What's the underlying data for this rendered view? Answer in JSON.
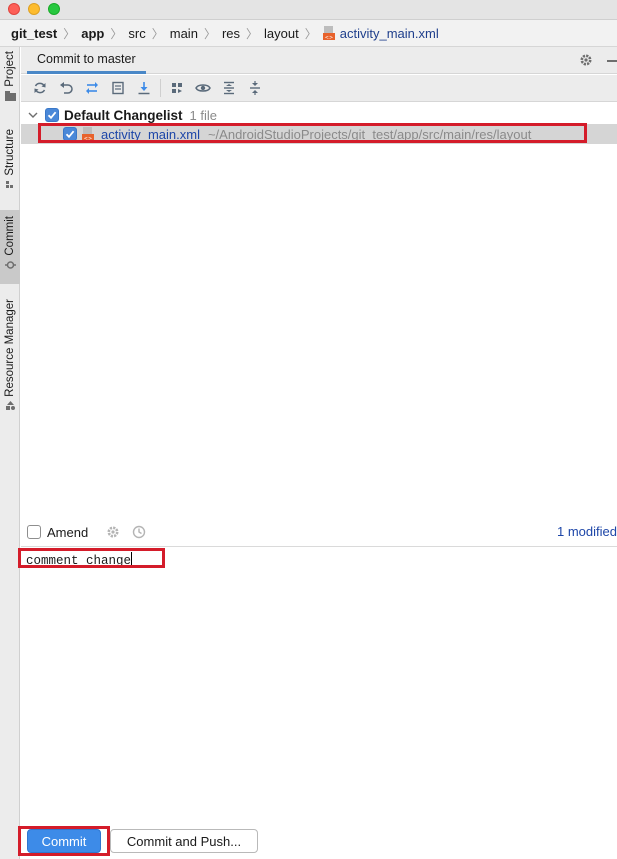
{
  "breadcrumb": {
    "items": [
      "git_test",
      "app",
      "src",
      "main",
      "res",
      "layout",
      "activity_main.xml"
    ]
  },
  "left_tabs": [
    "Project",
    "Structure",
    "Commit",
    "Resource Manager"
  ],
  "tool_window": {
    "tab_label": "Commit to master"
  },
  "toolbar": {
    "icons": [
      "refresh-icon",
      "rollback-icon",
      "diff-icon",
      "shelve-icon",
      "update-icon",
      "group-by-icon",
      "view-options-icon",
      "expand-all-icon",
      "collapse-all-icon"
    ]
  },
  "changes": {
    "group_name": "Default Changelist",
    "group_count": "1 file",
    "file_name": "activity_main.xml",
    "file_path": "~/AndroidStudioProjects/git_test/app/src/main/res/layout"
  },
  "options": {
    "amend_label": "Amend",
    "modified_link": "1 modified"
  },
  "message": {
    "text": "comment change"
  },
  "buttons": {
    "commit": "Commit",
    "commit_push": "Commit and Push..."
  },
  "colors": {
    "accent": "#3d8be8",
    "highlight": "#d41c2a",
    "link": "#1d46a8"
  }
}
